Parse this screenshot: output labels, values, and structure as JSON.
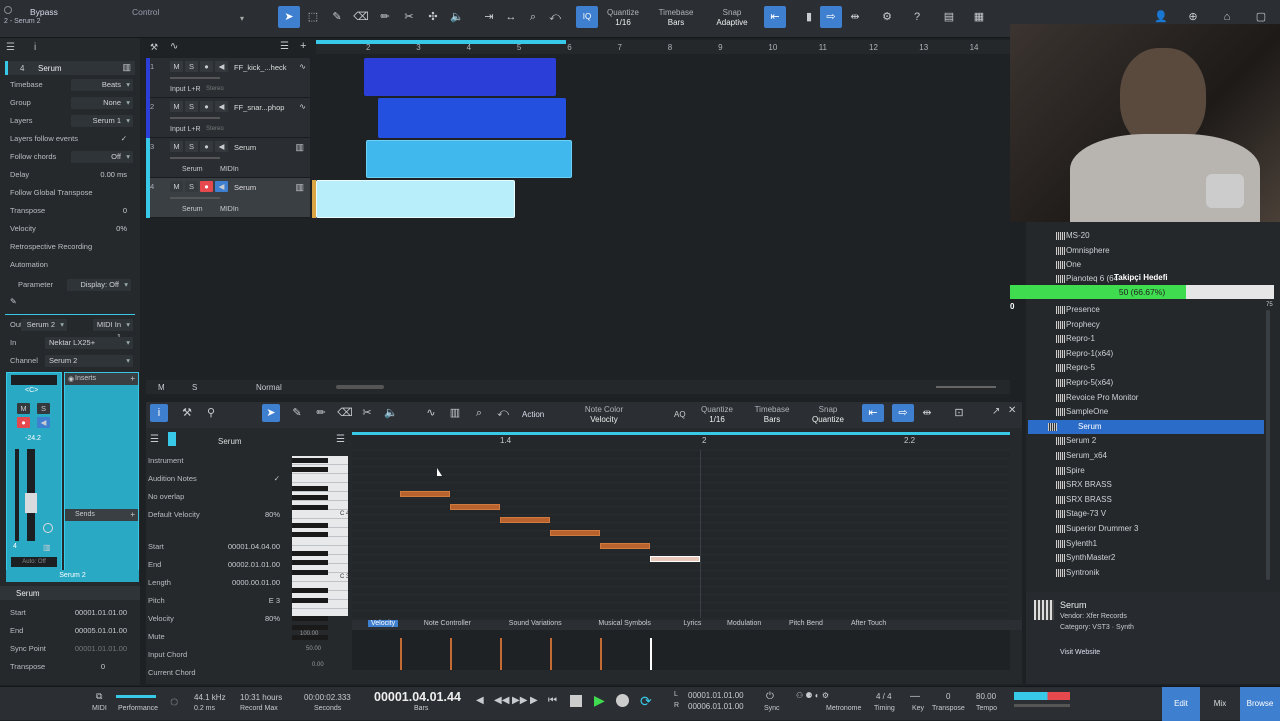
{
  "top": {
    "bypass": "Bypass",
    "song": "2 - Serum 2",
    "control": "Control",
    "quantize_label": "Quantize",
    "quantize_val": "1/16",
    "timebase_label": "Timebase",
    "timebase_val": "Bars",
    "snap_label": "Snap",
    "snap_val": "Adaptive",
    "iq": "IQ"
  },
  "inspector": {
    "track_num": "4",
    "track_name": "Serum",
    "rows": [
      {
        "l": "Timebase",
        "v": "Beats"
      },
      {
        "l": "Group",
        "v": "None"
      },
      {
        "l": "Layers",
        "v": "Serum 1"
      },
      {
        "l": "Layers follow events",
        "v": "✓"
      },
      {
        "l": "Follow chords",
        "v": "Off"
      },
      {
        "l": "Delay",
        "v": "0.00 ms"
      },
      {
        "l": "Follow Global Transpose",
        "v": ""
      },
      {
        "l": "Transpose",
        "v": "0"
      },
      {
        "l": "Velocity",
        "v": "0%"
      },
      {
        "l": "Retrospective Recording",
        "v": ""
      },
      {
        "l": "Automation",
        "v": ""
      }
    ],
    "parameter": "Parameter",
    "display": "Display: Off",
    "out_label": "Out",
    "out_val": "Serum 2",
    "midi_in": "MIDI In 1",
    "in_label": "In",
    "in_val": "Nektar LX25+",
    "channel_label": "Channel",
    "channel_val": "Serum 2",
    "inserts": "Inserts",
    "sends": "Sends",
    "fader_val": "-24.2",
    "auto": "Auto: Off",
    "ch_name": "Serum 2",
    "inst_name": "Serum",
    "start_l": "Start",
    "start_v": "00001.01.01.00",
    "end_l": "End",
    "end_v": "00005.01.01.00",
    "sync_l": "Sync Point",
    "sync_v": "00001.01.01.00",
    "tr_l": "Transpose",
    "tr_v": "0",
    "pan": "<C>"
  },
  "tracks": [
    {
      "n": "1",
      "name": "FF_kick_...heck",
      "input": "Input L+R",
      "stereo": "Stereo"
    },
    {
      "n": "2",
      "name": "FF_snar...phop",
      "input": "Input L+R",
      "stereo": "Stereo"
    },
    {
      "n": "3",
      "name": "Serum",
      "inst": "Serum",
      "midi": "MIDIn"
    },
    {
      "n": "4",
      "name": "Serum",
      "inst": "Serum",
      "midi": "MIDIn"
    }
  ],
  "ruler": [
    "2",
    "3",
    "4",
    "5",
    "6",
    "7",
    "8",
    "9",
    "10",
    "11",
    "12",
    "13",
    "14"
  ],
  "arr_footer": {
    "m": "M",
    "s": "S",
    "normal": "Normal"
  },
  "editor": {
    "notecolor_label": "Note Color",
    "notecolor_val": "Velocity",
    "action": "Action",
    "aq": "AQ",
    "quantize_label": "Quantize",
    "quantize_val": "1/16",
    "timebase_label": "Timebase",
    "timebase_val": "Bars",
    "snap_label": "Snap",
    "snap_val": "Quantize",
    "inst": "Serum",
    "ruler": [
      "1.4",
      "2",
      "2.2"
    ],
    "props": [
      {
        "l": "Instrument",
        "v": ""
      },
      {
        "l": "Audition Notes",
        "v": "✓"
      },
      {
        "l": "No overlap",
        "v": ""
      },
      {
        "l": "Default Velocity",
        "v": "80%"
      }
    ],
    "note_props": [
      {
        "l": "Start",
        "v": "00001.04.04.00"
      },
      {
        "l": "End",
        "v": "00002.01.01.00"
      },
      {
        "l": "Length",
        "v": "0000.00.01.00"
      },
      {
        "l": "Pitch",
        "v": "E 3"
      },
      {
        "l": "Velocity",
        "v": "80%"
      },
      {
        "l": "Mute",
        "v": ""
      },
      {
        "l": "Input Chord",
        "v": ""
      },
      {
        "l": "Current Chord",
        "v": ""
      }
    ],
    "c4": "C 4",
    "c3": "C 3",
    "tabs": [
      "Velocity",
      "Note Controller",
      "Sound Variations",
      "Musical Symbols",
      "Lyrics",
      "Modulation",
      "Pitch Bend",
      "After Touch"
    ],
    "vel_scale": [
      "100.00",
      "50.00",
      "0.00"
    ]
  },
  "browser": {
    "items": [
      "MS-20",
      "Omnisphere",
      "One",
      "Pianoteq 6 (64",
      "Presence",
      "Prophecy",
      "Repro-1",
      "Repro-1(x64)",
      "Repro-5",
      "Repro-5(x64)",
      "Revoice Pro Monitor",
      "SampleOne",
      "Serum",
      "Serum 2",
      "Serum_x64",
      "Spire",
      "SRX BRASS",
      "SRX BRASS",
      "Stage-73 V",
      "Superior Drummer 3",
      "Sylenth1",
      "SynthMaster2",
      "Syntronik"
    ],
    "selected": "Serum",
    "info_name": "Serum",
    "vendor": "Vendor:   Xfer Records",
    "category": "Category:  VST3 · Synth",
    "website": "Visit Website"
  },
  "overlay": {
    "title": "Takipçi Hedefi",
    "progress": "50 (66.67%)",
    "min": "0",
    "max": "75",
    "fraction": 0.6667
  },
  "bottom": {
    "midi": "MIDI",
    "perf": "Performance",
    "rate": "44.1 kHz",
    "latency": "0.2 ms",
    "rec_time": "10:31 hours",
    "rec_max": "Record Max",
    "secs": "00:00:02.333",
    "secs_l": "Seconds",
    "pos": "00001.04.01.44",
    "pos_l": "Bars",
    "l": "L",
    "l_val": "00001.01.01.00",
    "r": "R",
    "r_val": "00006.01.01.00",
    "sync": "Sync",
    "metronome": "Metronome",
    "timing": "Timing",
    "sig": "4 / 4",
    "key": "Key",
    "transpose_val": "0",
    "transpose": "Transpose",
    "tempo_val": "80.00",
    "tempo": "Tempo",
    "edit": "Edit",
    "mix": "Mix",
    "browse": "Browse"
  }
}
